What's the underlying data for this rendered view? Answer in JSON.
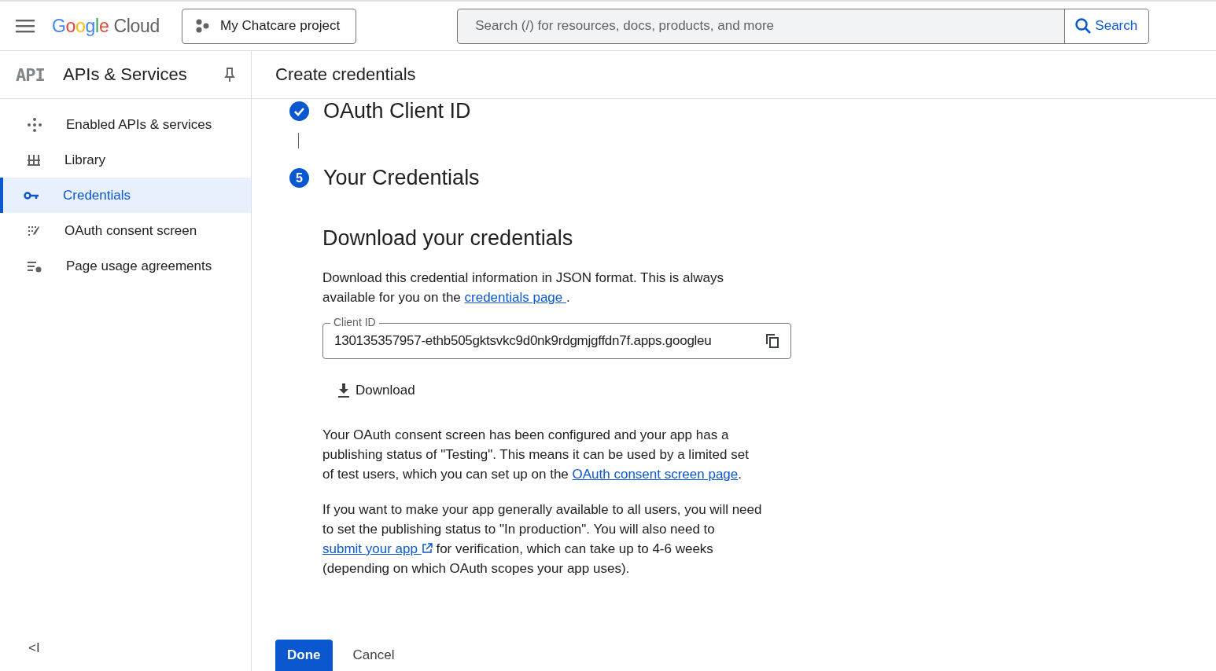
{
  "header": {
    "logo": {
      "brand": "Google",
      "product": "Cloud"
    },
    "project": "My Chatcare project",
    "search": {
      "placeholder": "Search (/) for resources, docs, products, and more",
      "button": "Search"
    }
  },
  "sidebar": {
    "badge": "API",
    "title": "APIs & Services",
    "items": [
      {
        "label": "Enabled APIs & services",
        "kind": "enabled",
        "selected": false
      },
      {
        "label": "Library",
        "kind": "library",
        "selected": false
      },
      {
        "label": "Credentials",
        "kind": "credentials",
        "selected": true
      },
      {
        "label": "OAuth consent screen",
        "kind": "consent",
        "selected": false
      },
      {
        "label": "Page usage agreements",
        "kind": "agreements",
        "selected": false
      }
    ],
    "collapse": "<I"
  },
  "page_title": "Create credentials",
  "steps": [
    {
      "title": "OAuth Client ID",
      "done": true
    },
    {
      "title": "Your Credentials",
      "done": false,
      "number": "5"
    }
  ],
  "section": {
    "heading": "Download your credentials",
    "intro": [
      {
        "kind": "text",
        "text": "Download this credential information in JSON format. This is always available for you on the "
      },
      {
        "kind": "link",
        "text": "credentials page "
      },
      {
        "kind": "text",
        "text": "."
      }
    ],
    "client_id": {
      "label": "Client ID",
      "value": "130135357957-ethb505gktsvkc9d0nk9rdgmjgffdn7f.apps.googleu"
    },
    "download": "Download",
    "paragraphs": [
      [
        {
          "kind": "text",
          "text": "Your OAuth consent screen has been configured and your app has a publishing status of \"Testing\". This means it can be used by a limited set of test users, which you can set up on the "
        },
        {
          "kind": "link",
          "text": "OAuth consent screen page"
        },
        {
          "kind": "text",
          "text": "."
        }
      ],
      [
        {
          "kind": "text",
          "text": "If you want to make your app generally available to all users, you will need to set the publishing status to \"In production\". You will also need to "
        },
        {
          "kind": "external",
          "text": "submit your app"
        },
        {
          "kind": "text",
          "text": " for verification, which can take up to 4-6 weeks (depending on which OAuth scopes your app uses)."
        }
      ]
    ]
  },
  "actions": {
    "primary": "Done",
    "secondary": "Cancel"
  }
}
